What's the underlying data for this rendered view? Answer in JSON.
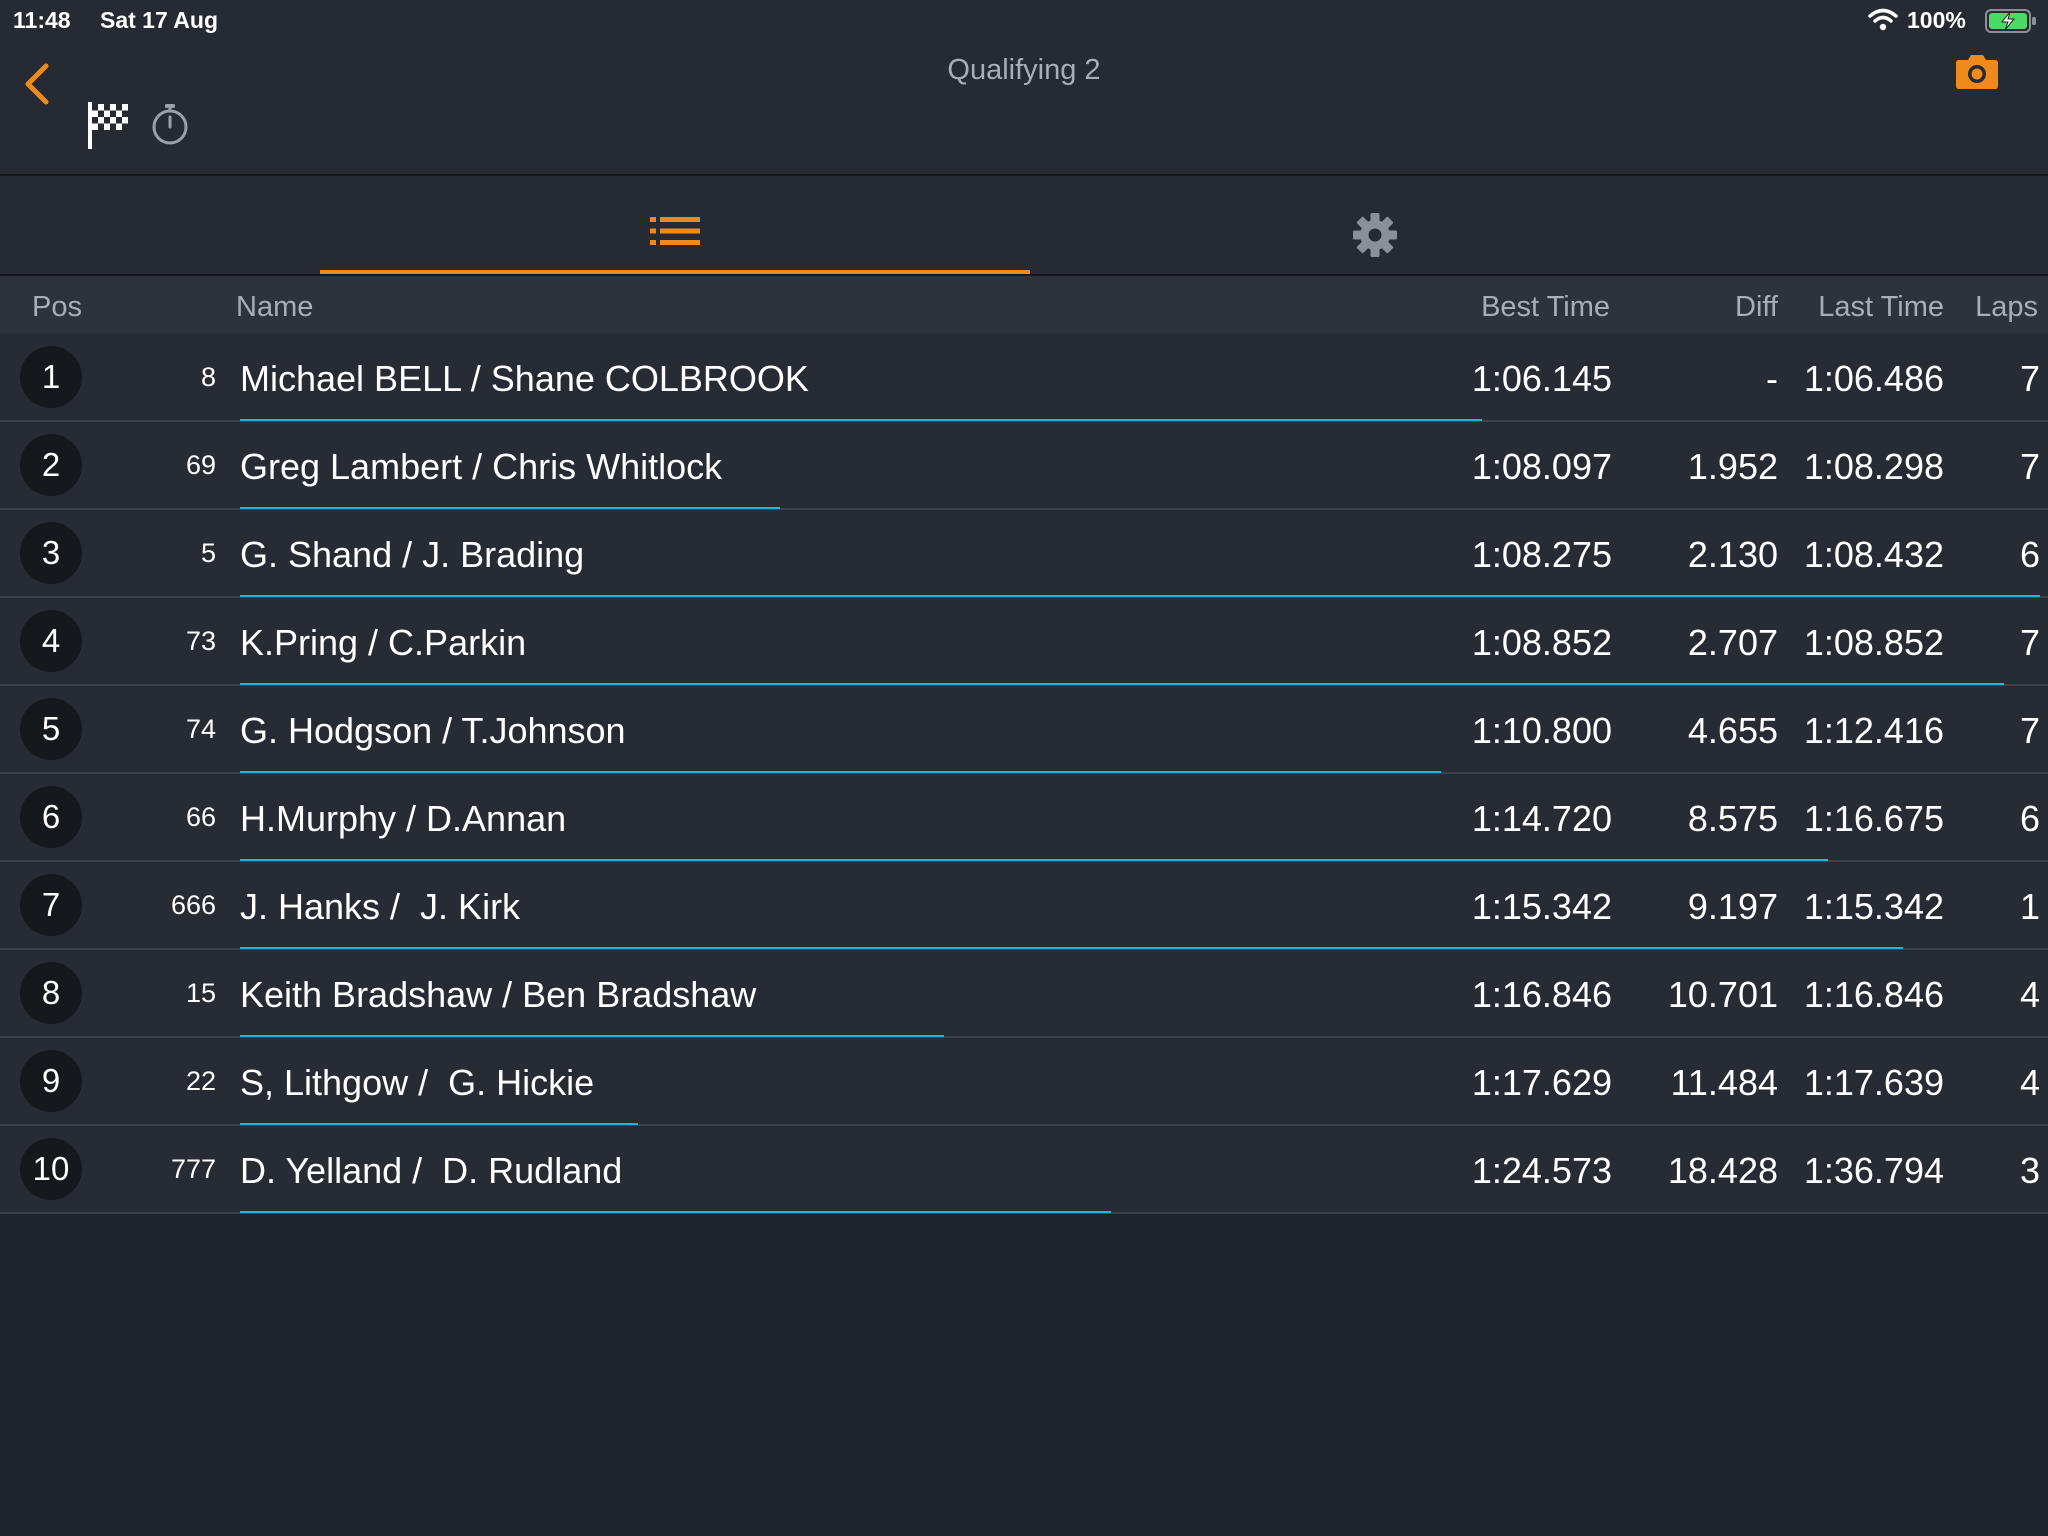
{
  "status_bar": {
    "time": "11:48",
    "date": "Sat 17 Aug",
    "battery_pct": "100%",
    "icons": [
      "wifi-icon",
      "battery-charging-icon"
    ]
  },
  "header": {
    "title": "Qualifying 2",
    "icons": [
      "back-chevron-icon",
      "checkered-flag-icon",
      "stopwatch-icon",
      "camera-icon"
    ]
  },
  "tabs": [
    {
      "icon": "list-icon",
      "active": true
    },
    {
      "icon": "gear-icon",
      "active": false
    }
  ],
  "colors": {
    "accent": "#f08a1c",
    "progress": "#1bb8d6",
    "background": "#1f232b",
    "row_bg": "#272b34"
  },
  "table": {
    "columns": {
      "pos": "Pos",
      "name": "Name",
      "best": "Best Time",
      "diff": "Diff",
      "last": "Last Time",
      "laps": "Laps"
    },
    "rows": [
      {
        "pos": "1",
        "car": "8",
        "name": "Michael BELL / Shane COLBROOK",
        "best": "1:06.145",
        "diff": "-",
        "last": "1:06.486",
        "laps": "7",
        "progress": 0.69
      },
      {
        "pos": "2",
        "car": "69",
        "name": "Greg Lambert / Chris Whitlock",
        "best": "1:08.097",
        "diff": "1.952",
        "last": "1:08.298",
        "laps": "7",
        "progress": 0.3
      },
      {
        "pos": "3",
        "car": "5",
        "name": "G. Shand / J. Brading",
        "best": "1:08.275",
        "diff": "2.130",
        "last": "1:08.432",
        "laps": "6",
        "progress": 1.0
      },
      {
        "pos": "4",
        "car": "73",
        "name": "K.Pring / C.Parkin",
        "best": "1:08.852",
        "diff": "2.707",
        "last": "1:08.852",
        "laps": "7",
        "progress": 0.98
      },
      {
        "pos": "5",
        "car": "74",
        "name": "G. Hodgson / T.Johnson",
        "best": "1:10.800",
        "diff": "4.655",
        "last": "1:12.416",
        "laps": "7",
        "progress": 0.667
      },
      {
        "pos": "6",
        "car": "66",
        "name": "H.Murphy / D.Annan",
        "best": "1:14.720",
        "diff": "8.575",
        "last": "1:16.675",
        "laps": "6",
        "progress": 0.882
      },
      {
        "pos": "7",
        "car": "666",
        "name": "J. Hanks /  J. Kirk",
        "best": "1:15.342",
        "diff": "9.197",
        "last": "1:15.342",
        "laps": "1",
        "progress": 0.924
      },
      {
        "pos": "8",
        "car": "15",
        "name": "Keith Bradshaw / Ben Bradshaw",
        "best": "1:16.846",
        "diff": "10.701",
        "last": "1:16.846",
        "laps": "4",
        "progress": 0.391
      },
      {
        "pos": "9",
        "car": "22",
        "name": "S, Lithgow /  G. Hickie",
        "best": "1:17.629",
        "diff": "11.484",
        "last": "1:17.639",
        "laps": "4",
        "progress": 0.221
      },
      {
        "pos": "10",
        "car": "777",
        "name": "D. Yelland /  D. Rudland",
        "best": "1:24.573",
        "diff": "18.428",
        "last": "1:36.794",
        "laps": "3",
        "progress": 0.484
      }
    ]
  }
}
